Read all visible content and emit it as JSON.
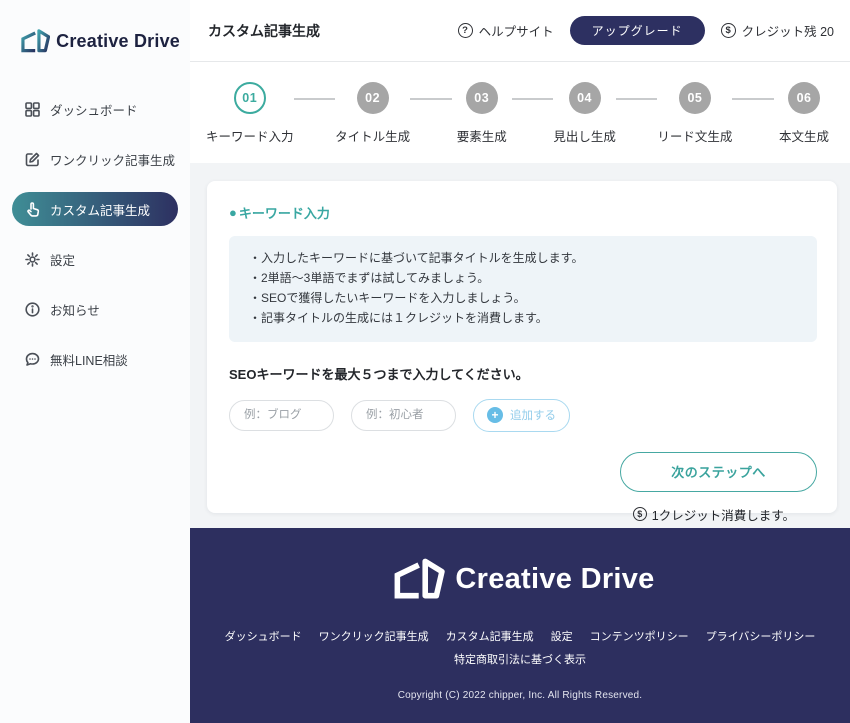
{
  "brand": {
    "name": "Creative Drive"
  },
  "colors": {
    "accent_teal": "#3aa8a3",
    "accent_light_blue": "#8ccbeb",
    "navy": "#2d2f5f",
    "step_inactive_gray": "#a6a6a6",
    "tips_box_bg": "#eef4f8",
    "active_gradient_start": "#3f8e96",
    "active_gradient_end": "#2d3061"
  },
  "sidebar": {
    "items": [
      {
        "id": "dashboard",
        "icon": "dashboard-icon",
        "label": "ダッシュボード",
        "active": false
      },
      {
        "id": "one-click-generation",
        "icon": "edit-icon",
        "label": "ワンクリック記事生成",
        "active": false
      },
      {
        "id": "custom-generation",
        "icon": "hand-pointer-icon",
        "label": "カスタム記事生成",
        "active": true
      },
      {
        "id": "settings",
        "icon": "gear-icon",
        "label": "設定",
        "active": false
      },
      {
        "id": "news",
        "icon": "info-icon",
        "label": "お知らせ",
        "active": false
      },
      {
        "id": "line-consultation",
        "icon": "chat-icon",
        "label": "無料LINE相談",
        "active": false
      }
    ]
  },
  "header": {
    "title": "カスタム記事生成",
    "help_label": "ヘルプサイト",
    "help_icon_glyph": "?",
    "upgrade_label": "アップグレード",
    "credit_label": "クレジット残 20",
    "credit_icon_glyph": "$"
  },
  "steps": [
    {
      "number": "01",
      "label": "キーワード入力",
      "active": true
    },
    {
      "number": "02",
      "label": "タイトル生成",
      "active": false
    },
    {
      "number": "03",
      "label": "要素生成",
      "active": false
    },
    {
      "number": "04",
      "label": "見出し生成",
      "active": false
    },
    {
      "number": "05",
      "label": "リード文生成",
      "active": false
    },
    {
      "number": "06",
      "label": "本文生成",
      "active": false
    }
  ],
  "main": {
    "section_bullet": "●",
    "section_title": "キーワード入力",
    "tips": [
      "・入力したキーワードに基づいて記事タイトルを生成します。",
      "・2単語〜3単語でまずは試してみましょう。",
      "・SEOで獲得したいキーワードを入力しましょう。",
      "・記事タイトルの生成には１クレジットを消費します。"
    ],
    "keyword_prompt": "SEOキーワードを最大５つまで入力してください。",
    "inputs": [
      {
        "placeholder": "例：ブログ",
        "value": ""
      },
      {
        "placeholder": "例：初心者",
        "value": ""
      }
    ],
    "add_button_label": "追加する",
    "add_icon_glyph": "+",
    "next_button_label": "次のステップへ",
    "credit_note": "1クレジット消費します。",
    "credit_icon_glyph": "$"
  },
  "footer": {
    "brand": "Creative Drive",
    "links": [
      "ダッシュボード",
      "ワンクリック記事生成",
      "カスタム記事生成",
      "設定",
      "コンテンツポリシー",
      "プライバシーポリシー"
    ],
    "links_row2": [
      "特定商取引法に基づく表示"
    ],
    "copyright": "Copyright (C) 2022 chipper, Inc. All Rights Reserved."
  }
}
